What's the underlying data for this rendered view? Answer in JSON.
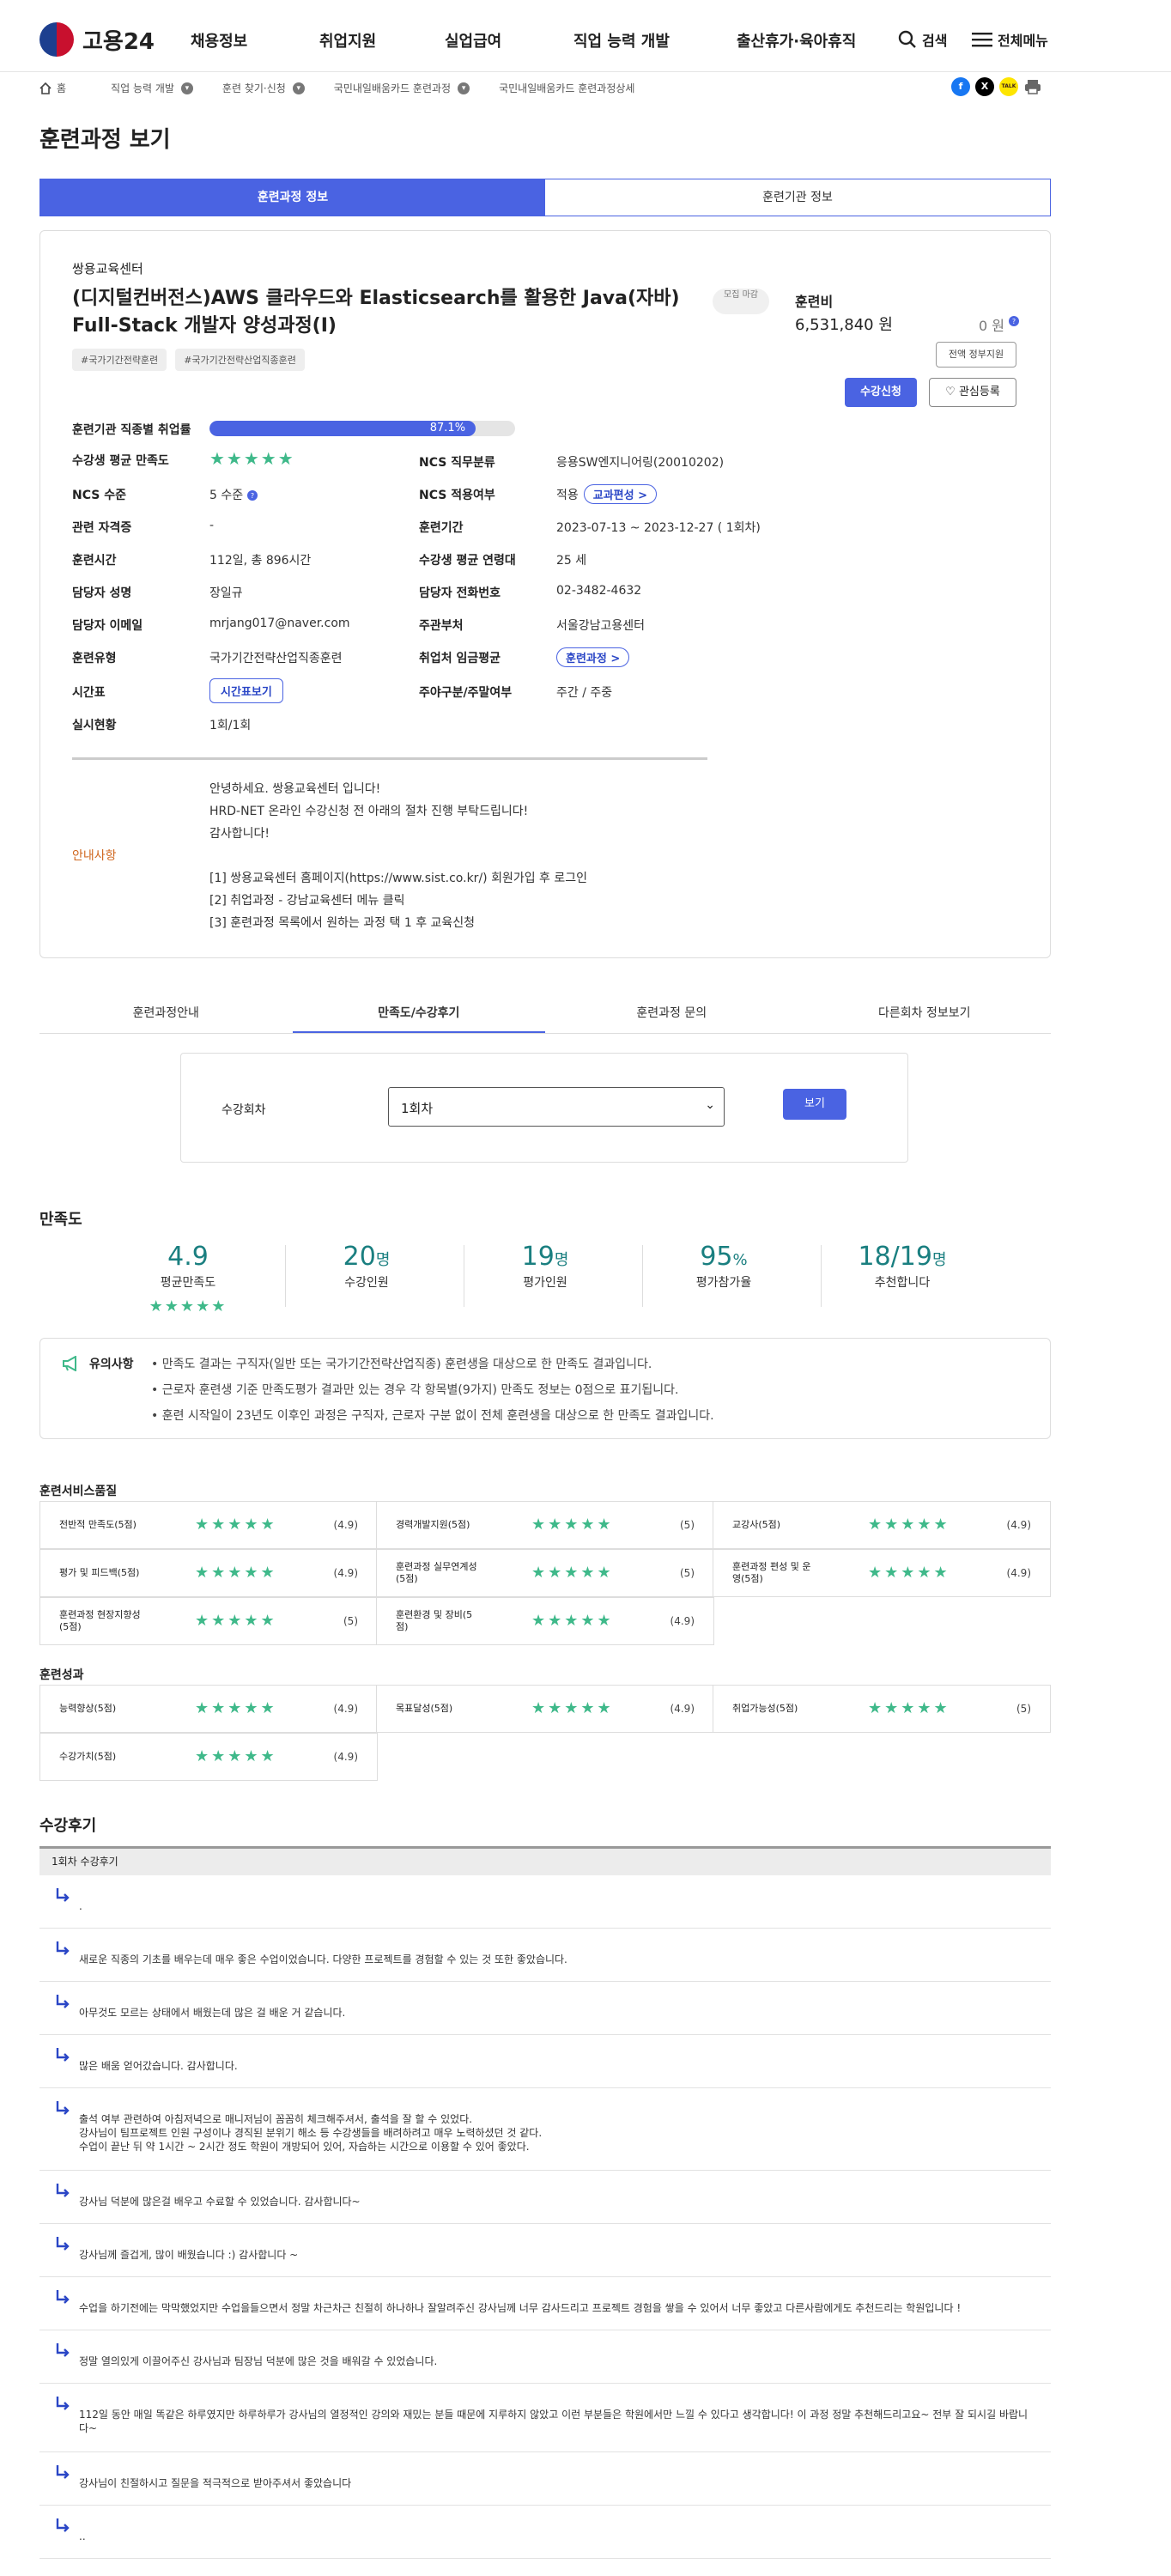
{
  "header": {
    "logo_text": "고용24",
    "menu": [
      "채용정보",
      "취업지원",
      "실업급여",
      "직업 능력 개발",
      "출산휴가·육아휴직"
    ],
    "search_label": "검색",
    "all_menu_label": "전체메뉴"
  },
  "breadcrumb": [
    "홈",
    "직업 능력 개발",
    "훈련 찾기·신청",
    "국민내일배움카드 훈련과정",
    "국민내일배움카드 훈련과정상세"
  ],
  "share": {
    "facebook": "f",
    "x": "X",
    "kakao": "TALK"
  },
  "page_title": "훈련과정 보기",
  "top_tabs": [
    "훈련과정 정보",
    "훈련기관 정보"
  ],
  "course": {
    "institution": "쌍용교육센터",
    "title": "(디지털컨버전스)AWS 클라우드와 Elasticsearch를 활용한 Java(자바) Full-Stack 개발자 양성과정(I)",
    "recruit_badge": "모집 마감",
    "tags": [
      "#국가기간전략훈련",
      "#국가기간전략산업직종훈련"
    ],
    "fee_label": "훈련비",
    "fee_value": "6,531,840 원",
    "fee_self": "0 원",
    "support_btn": "전액 정부지원",
    "apply_btn": "수강신청",
    "wish_btn": "♡ 관심등록"
  },
  "details": {
    "employment_rate_label": "훈련기관 직종별 취업률",
    "employment_rate": 87.1,
    "employment_rate_text": "87.1%",
    "rows": {
      "satisfaction_label": "수강생 평균 만족도",
      "ncs_job_label": "NCS 직무분류",
      "ncs_job_value": "응용SW엔지니어링(20010202)",
      "ncs_level_label": "NCS 수준",
      "ncs_level_value": "5 수준",
      "ncs_apply_label": "NCS 적용여부",
      "ncs_apply_value": "적용",
      "curriculum_btn": "교과편성 >",
      "cert_label": "관련 자격증",
      "cert_value": "-",
      "period_label": "훈련기간",
      "period_value": "2023-07-13 ~ 2023-12-27 ( 1회차)",
      "hours_label": "훈련시간",
      "hours_value": "112일, 총 896시간",
      "age_label": "수강생 평균 연령대",
      "age_value": "25 세",
      "manager_label": "담당자 성명",
      "manager_value": "장일규",
      "phone_label": "담당자 전화번호",
      "phone_value": "02-3482-4632",
      "email_label": "담당자 이메일",
      "email_value": "mrjang017@naver.com",
      "ministry_label": "주관부처",
      "ministry_value": "서울강남고용센터",
      "type_label": "훈련유형",
      "type_value": "국가기간전략산업직종훈련",
      "wage_label": "취업처 임금평균",
      "wage_btn": "훈련과정 >",
      "timetable_label": "시간표",
      "timetable_btn": "시간표보기",
      "weekday_label": "주야구분/주말여부",
      "weekday_value": "주간 / 주중",
      "status_label": "실시현황",
      "status_value": "1회/1회"
    }
  },
  "notice": {
    "label": "안내사항",
    "lines": [
      "안녕하세요. 쌍용교육센터 입니다!",
      "HRD-NET 온라인 수강신청 전 아래의 절차 진행 부탁드립니다!",
      "감사합니다!",
      "",
      "[1] 쌍용교육센터 홈페이지(https://www.sist.co.kr/) 회원가입 후 로그인",
      "[2] 취업과정 - 강남교육센터 메뉴 클릭",
      "[3] 훈련과정 목록에서 원하는 과정 택 1 후 교육신청"
    ]
  },
  "sub_tabs": [
    "훈련과정안내",
    "만족도/수강후기",
    "훈련과정 문의",
    "다른회차 정보보기"
  ],
  "filter": {
    "label": "수강회차",
    "selected": "1회차",
    "button": "보기"
  },
  "satisfaction": {
    "title": "만족도",
    "stats": [
      {
        "num": "4.9",
        "unit": "",
        "label": "평균만족도"
      },
      {
        "num": "20",
        "unit": "명",
        "label": "수강인원"
      },
      {
        "num": "19",
        "unit": "명",
        "label": "평가인원"
      },
      {
        "num": "95",
        "unit": "%",
        "label": "평가참가율"
      },
      {
        "num": "18/19",
        "unit": "명",
        "label": "추천합니다"
      }
    ],
    "avg_stars": 4.9
  },
  "caution": {
    "title": "유의사항",
    "lines": [
      "• 만족도 결과는 구직자(일반 또는 국가기간전략산업직종) 훈련생을 대상으로 한 만족도 결과입니다.",
      "• 근로자 훈련생 기준 만족도평가 결과만 있는 경우 각 항목별(9가지) 만족도 정보는 0점으로 표기됩니다.",
      "• 훈련 시작일이 23년도 이후인 과정은 구직자, 근로자 구분 없이 전체 훈련생을 대상으로 한 만족도 결과입니다."
    ]
  },
  "service_quality": {
    "title": "훈련서비스품질",
    "items": [
      {
        "name": "전반적 만족도(5점)",
        "score": "(4.9)"
      },
      {
        "name": "경력개발지원(5점)",
        "score": "(5)"
      },
      {
        "name": "교강사(5점)",
        "score": "(4.9)"
      },
      {
        "name": "평가 및 피드백(5점)",
        "score": "(4.9)"
      },
      {
        "name": "훈련과정 실무연계성(5점)",
        "score": "(5)"
      },
      {
        "name": "훈련과정 편성 및 운영(5점)",
        "score": "(4.9)"
      },
      {
        "name": "훈련과정 현장지향성(5점)",
        "score": "(5)"
      },
      {
        "name": "훈련환경 및 장비(5점)",
        "score": "(4.9)"
      }
    ]
  },
  "outcomes": {
    "title": "훈련성과",
    "items": [
      {
        "name": "능력향상(5점)",
        "score": "(4.9)"
      },
      {
        "name": "목표달성(5점)",
        "score": "(4.9)"
      },
      {
        "name": "취업가능성(5점)",
        "score": "(5)"
      },
      {
        "name": "수강가치(5점)",
        "score": "(4.9)"
      }
    ]
  },
  "reviews": {
    "title": "수강후기",
    "header": "1회차 수강후기",
    "items": [
      ".",
      "새로운 직종의 기초를 배우는데 매우 좋은 수업이었습니다. 다양한 프로젝트를 경험할 수 있는 것 또한 좋았습니다.",
      "아무것도 모르는 상태에서 배웠는데 많은 걸 배운 거 같습니다.",
      "많은 배움 얻어갔습니다. 감사합니다.",
      "출석 여부 관련하여 아침저녁으로 매니저님이 꼼꼼히 체크해주셔서, 출석을 잘 할 수 있었다.\n강사님이 팀프로젝트 인원 구성이나 경직된 분위기 해소 등 수강생들을 배려하려고 매우 노력하셨던 것 같다.\n수업이 끝난 뒤 약 1시간 ~ 2시간 정도 학원이 개방되어 있어, 자습하는 시간으로 이용할 수 있어 좋았다.",
      "강사님 덕분에 많은걸 배우고 수료할 수 있었습니다. 감사합니다~",
      "강사님께 즐겁게, 많이 배웠습니다 :) 감사합니다 ~",
      "수업을 하기전에는 막막했었지만 수업을들으면서 정말 차근차근 친절히 하나하나 잘알려주신 강사님께 너무 감사드리고 프로젝트 경험을 쌓을 수 있어서 너무 좋았고 다른사람에게도 추천드리는 학원입니다 !",
      "정말 열의있게 이끌어주신 강사님과 팀장님 덕분에 많은 것을 배워갈 수 있었습니다.",
      "112일 동안 매일 똑같은 하루였지만 하루하루가 강사님의 열정적인 강의와 재밌는 분들 때문에 지루하지 않았고 이런 부분들은 학원에서만 느낄 수 있다고 생각합니다! 이 과정 정말 추천해드리고요~ 전부 잘 되시길 바랍니다~",
      "강사님이 친절하시고 질문을 적극적으로 받아주셔서 좋았습니다",
      ".."
    ]
  },
  "colors": {
    "primary": "#4a63e2",
    "star": "#3fb98a",
    "stat": "#1a7f80",
    "notice": "#d0671f"
  },
  "icons": [
    "search-icon",
    "hamburger-icon",
    "home-icon",
    "chevron-right-icon",
    "print-icon",
    "megaphone-icon",
    "reply-arrow-icon",
    "info-icon"
  ]
}
